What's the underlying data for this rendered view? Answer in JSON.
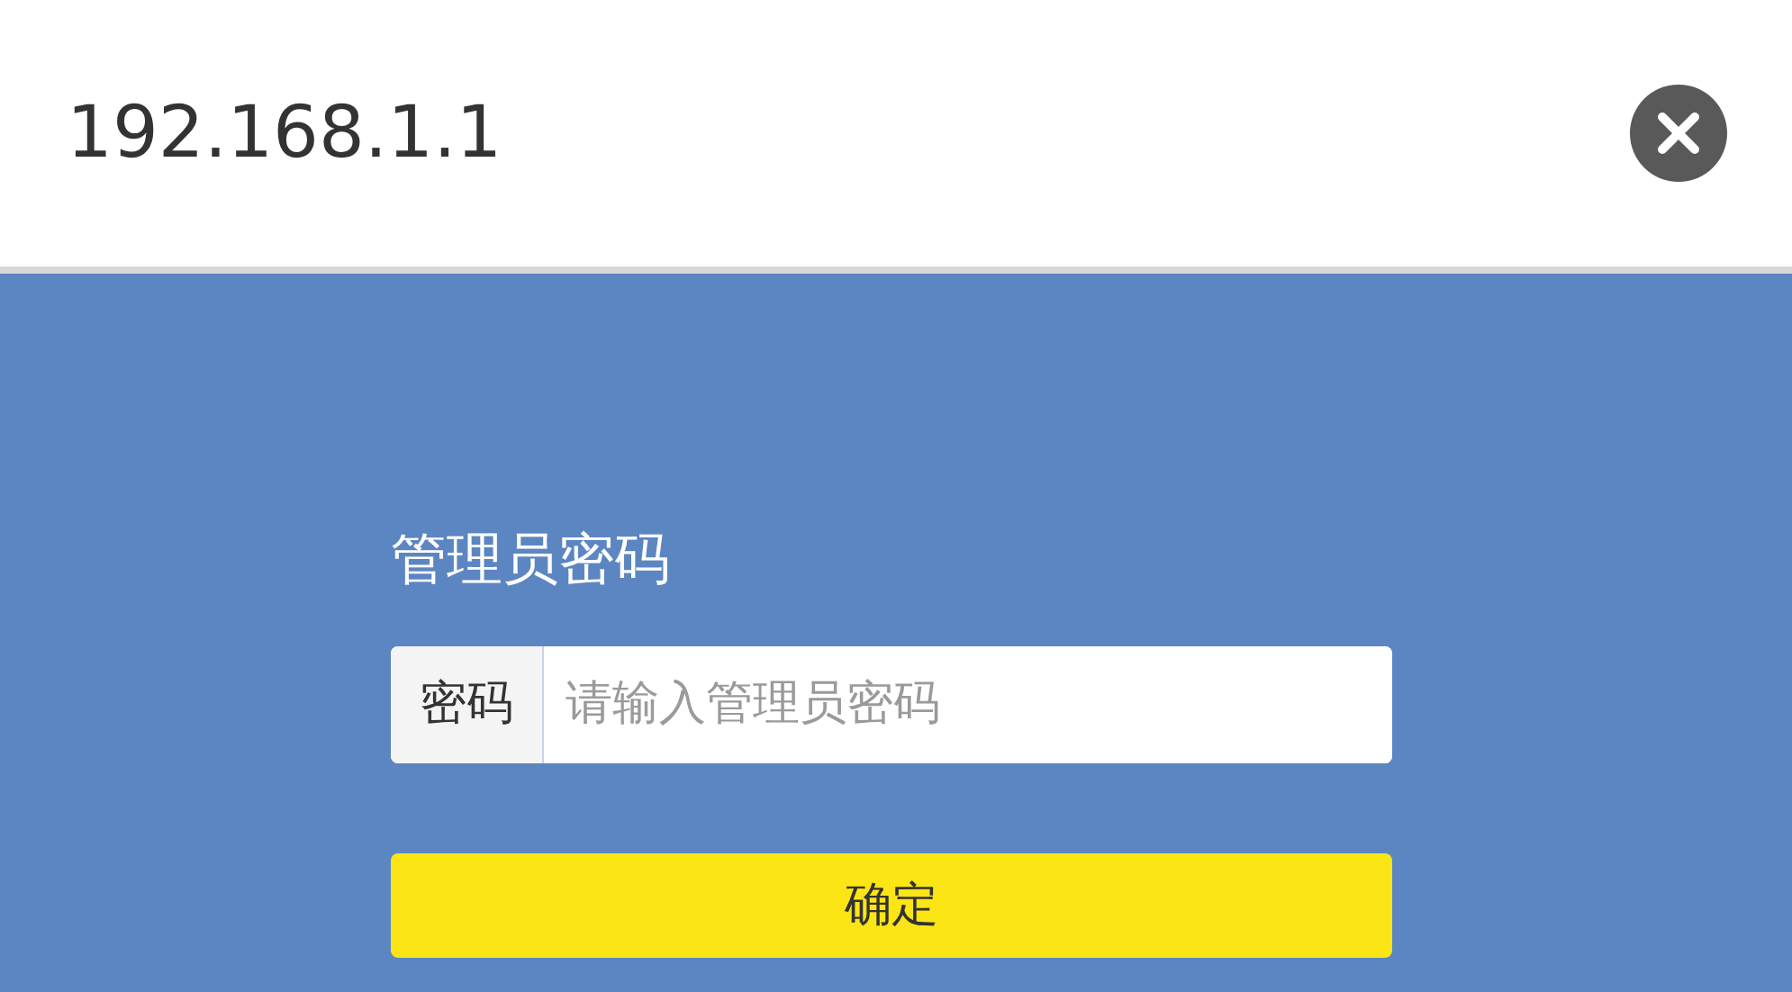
{
  "address_bar": {
    "url": "192.168.1.1"
  },
  "login": {
    "title": "管理员密码",
    "password_field": {
      "label": "密码",
      "placeholder": "请输入管理员密码"
    },
    "submit_button": "确定"
  }
}
